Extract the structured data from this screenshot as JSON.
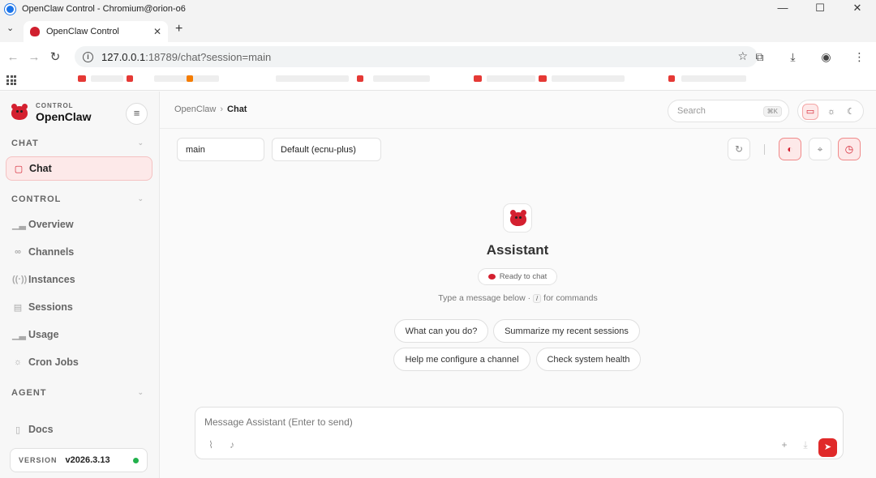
{
  "window": {
    "title": "OpenClaw Control - Chromium@orion-o6",
    "minimize": "—",
    "maximize": "☐",
    "close": "✕"
  },
  "browser": {
    "tab_title": "OpenClaw Control",
    "url_host": "127.0.0.1",
    "url_rest": ":18789/chat?session=main"
  },
  "sidebar": {
    "brand_sub": "CONTROL",
    "brand_name": "OpenClaw",
    "sections": {
      "chat": "CHAT",
      "control": "CONTROL",
      "agent": "AGENT"
    },
    "items": [
      {
        "label": "Chat",
        "icon": "chat-bubble-icon"
      },
      {
        "label": "Overview",
        "icon": "bar-chart-icon"
      },
      {
        "label": "Channels",
        "icon": "link-icon"
      },
      {
        "label": "Instances",
        "icon": "broadcast-icon"
      },
      {
        "label": "Sessions",
        "icon": "document-icon"
      },
      {
        "label": "Usage",
        "icon": "bar-chart-icon"
      },
      {
        "label": "Cron Jobs",
        "icon": "sun-icon"
      },
      {
        "label": "Docs",
        "icon": "book-icon"
      }
    ],
    "version_label": "VERSION",
    "version_value": "v2026.3.13",
    "status_color": "#22b14c"
  },
  "header": {
    "breadcrumb_root": "OpenClaw",
    "breadcrumb_current": "Chat",
    "search_placeholder": "Search",
    "search_shortcut": "⌘K"
  },
  "controls": {
    "session": "main",
    "model": "Default (ecnu-plus)"
  },
  "welcome": {
    "title": "Assistant",
    "status": "Ready to chat",
    "hint_before": "Type a message below ·",
    "hint_key": "/",
    "hint_after": "for commands",
    "suggestions": [
      "What can you do?",
      "Summarize my recent sessions",
      "Help me configure a channel",
      "Check system health"
    ]
  },
  "composer": {
    "placeholder": "Message Assistant (Enter to send)"
  },
  "colors": {
    "accent": "#d42030",
    "send": "#e02a2a"
  }
}
